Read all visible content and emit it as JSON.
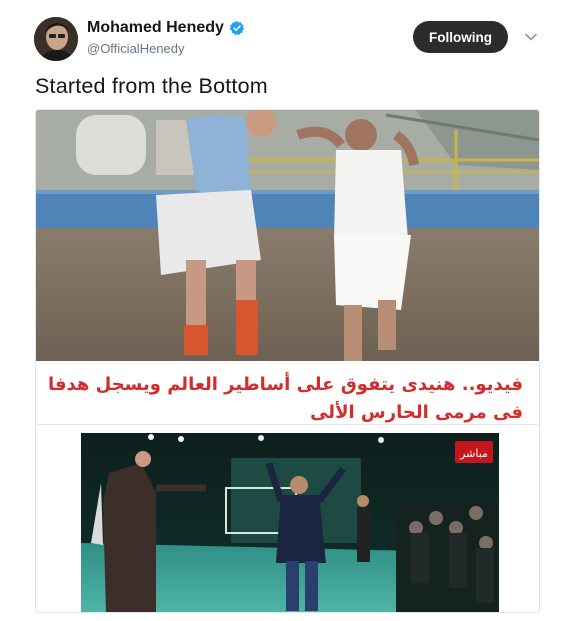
{
  "author": {
    "display_name": "Mohamed Henedy",
    "handle": "@OfficialHenedy",
    "verified": true,
    "avatar_icon": "profile-photo"
  },
  "actions": {
    "follow_label": "Following",
    "menu_icon": "chevron-down-icon"
  },
  "tweet": {
    "text": "Started from the Bottom"
  },
  "card": {
    "headline": "فيديو.. هنيدى يتفوق على أساطير العالم ويسجل هدفا فى مرمى الحارس الألى",
    "headline_color": "#d22c2c",
    "channel_logo_text": "مباشر"
  },
  "colors": {
    "follow_button_bg": "#2c2c2c",
    "verified_blue": "#1da1f2",
    "text_primary": "#14171a",
    "text_secondary": "#657786"
  }
}
